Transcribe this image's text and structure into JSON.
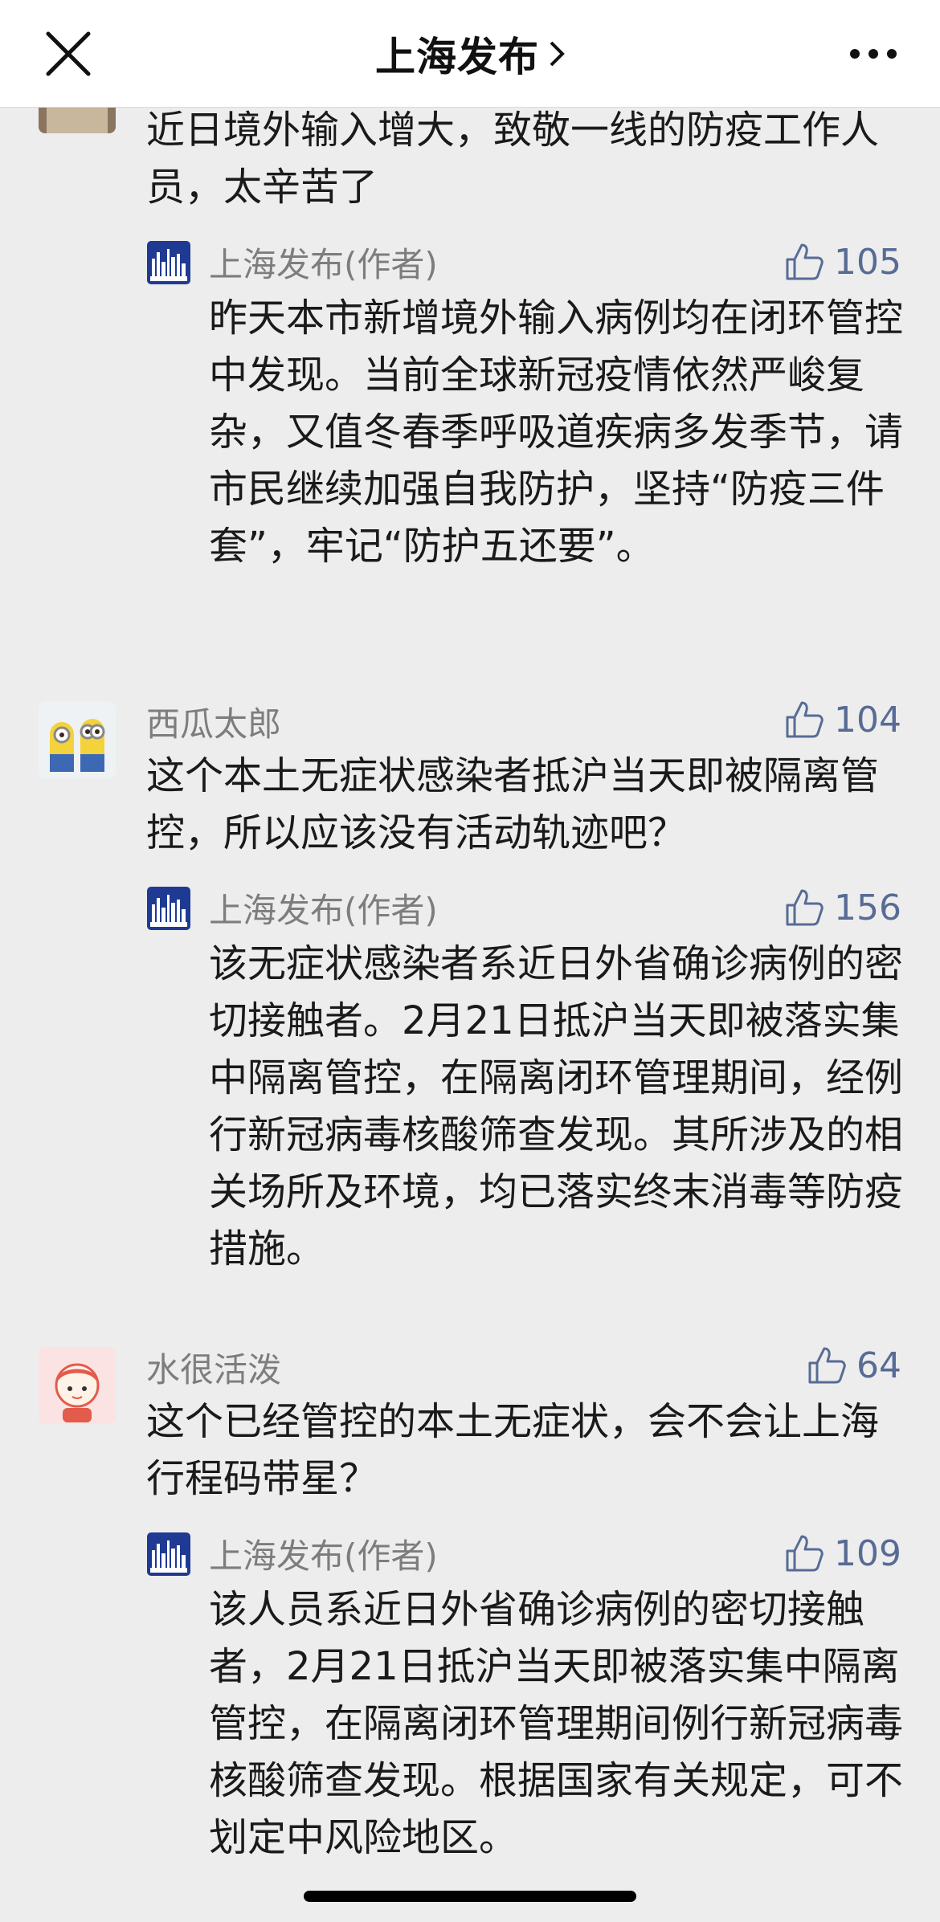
{
  "header": {
    "title": "上海发布",
    "close_icon": "close-icon",
    "chevron_icon": "chevron-right-icon",
    "more_icon": "more-icon"
  },
  "comments": [
    {
      "name": "",
      "text": "近日境外输入增大，致敬一线的防疫工作人员，太辛苦了",
      "avatar_icon": "user-avatar",
      "reply": {
        "name": "上海发布(作者)",
        "likes": "105",
        "text": "昨天本市新增境外输入病例均在闭环管控中发现。当前全球新冠疫情依然严峻复杂，又值冬春季呼吸道疾病多发季节，请市民继续加强自我防护，坚持“防疫三件套”，牢记“防护五还要”。"
      }
    },
    {
      "name": "西瓜太郎",
      "likes": "104",
      "text": "这个本土无症状感染者抵沪当天即被隔离管控，所以应该没有活动轨迹吧？",
      "reply": {
        "name": "上海发布(作者)",
        "likes": "156",
        "text": "该无症状感染者系近日外省确诊病例的密切接触者。2月21日抵沪当天即被落实集中隔离管控，在隔离闭环管理期间，经例行新冠病毒核酸筛查发现。其所涉及的相关场所及环境，均已落实终末消毒等防疫措施。"
      }
    },
    {
      "name": "水很活泼",
      "likes": "64",
      "text": "这个已经管控的本土无症状，会不会让上海行程码带星？",
      "reply": {
        "name": "上海发布(作者)",
        "likes": "109",
        "text": "该人员系近日外省确诊病例的密切接触者，2月21日抵沪当天即被落实集中隔离管控，在隔离闭环管理期间例行新冠病毒核酸筛查发现。根据国家有关规定，可不划定中风险地区。"
      }
    }
  ],
  "colors": {
    "background": "#ededed",
    "link": "#576b95",
    "secondary_text": "#7d7d7d",
    "logo_blue": "#1f3a93"
  }
}
